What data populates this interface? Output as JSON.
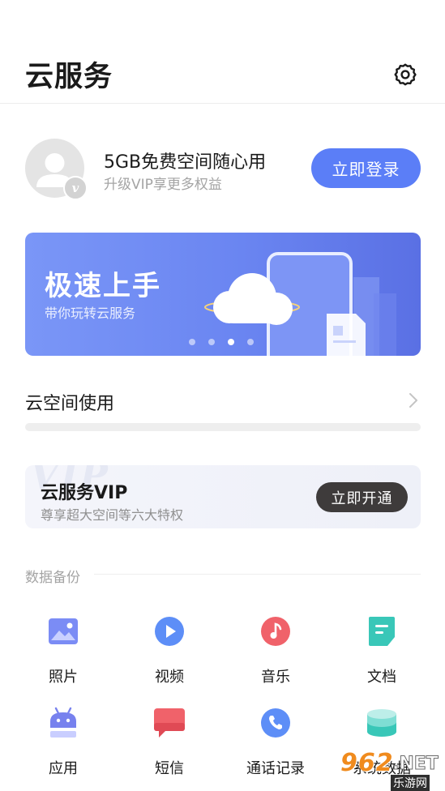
{
  "header": {
    "title": "云服务",
    "settings_icon": "gear-icon"
  },
  "account": {
    "avatar_icon": "user-avatar-icon",
    "badge_text": "v",
    "title": "5GB免费空间随心用",
    "subtitle": "升级VIP享更多权益",
    "login_label": "立即登录",
    "accent": "#5b7ef7"
  },
  "banner": {
    "title": "极速上手",
    "subtitle": "带你玩转云服务",
    "page_count": 4,
    "active_page": 3
  },
  "space": {
    "label": "云空间使用",
    "chevron_icon": "chevron-right-icon"
  },
  "vip": {
    "watermark": "VIP",
    "title": "云服务VIP",
    "subtitle": "尊享超大空间等六大特权",
    "button_label": "立即开通"
  },
  "backup": {
    "section_label": "数据备份",
    "items": [
      {
        "label": "照片",
        "icon": "photo-icon",
        "color": "#7b8cf5"
      },
      {
        "label": "视频",
        "icon": "video-icon",
        "color": "#5d8ef7"
      },
      {
        "label": "音乐",
        "icon": "music-icon",
        "color": "#f0626a"
      },
      {
        "label": "文档",
        "icon": "document-icon",
        "color": "#39c7b8"
      },
      {
        "label": "应用",
        "icon": "android-icon",
        "color": "#7781ee"
      },
      {
        "label": "短信",
        "icon": "message-icon",
        "color": "#f0626a"
      },
      {
        "label": "通话记录",
        "icon": "phone-icon",
        "color": "#5d8ef7"
      },
      {
        "label": "系统数据",
        "icon": "system-data-icon",
        "color": "#39c7b8"
      }
    ]
  },
  "watermark": {
    "number": "962",
    "net": ".NET",
    "site": "乐游网"
  }
}
